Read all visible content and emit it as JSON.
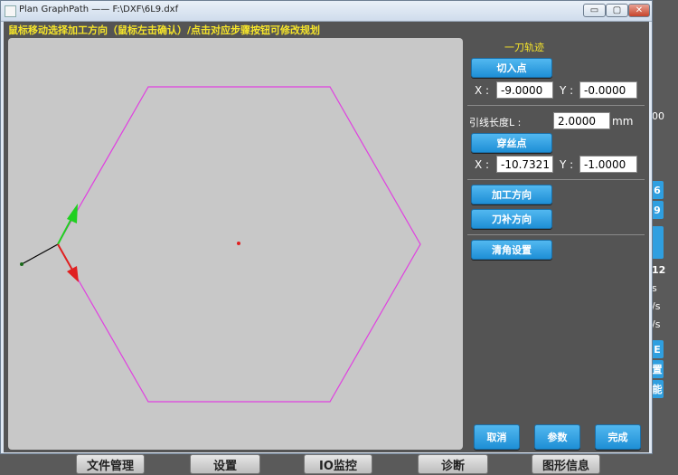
{
  "window": {
    "title": "Plan GraphPath —— F:\\DXF\\6L9.dxf",
    "min_glyph": "▭",
    "max_glyph": "▢",
    "close_glyph": "✕"
  },
  "instruction": "鼠标移动选择加工方向（鼠标左击确认）/点击对应步骤按钮可修改规划",
  "panel": {
    "title": "一刀轨迹",
    "cut_in_button": "切入点",
    "cut_in": {
      "x_label": "X :",
      "x_value": "-9.0000",
      "y_label": "Y :",
      "y_value": "-0.0000"
    },
    "lead_length_label": "引线长度L :",
    "lead_length_value": "2.0000",
    "lead_length_unit": "mm",
    "pierce_button": "穿丝点",
    "pierce": {
      "x_label": "X :",
      "x_value": "-10.7321",
      "y_label": "Y :",
      "y_value": "-1.0000"
    },
    "process_direction_button": "加工方向",
    "compensation_direction_button": "刀补方向",
    "corner_settings_button": "清角设置"
  },
  "footer": {
    "cancel_button": "取消",
    "params_button": "参数",
    "finish_button": "完成"
  },
  "background_app": {
    "bottom_buttons": [
      "文件管理",
      "设置",
      "IO监控",
      "诊断",
      "图形信息"
    ],
    "right_fragments": [
      "00",
      "6",
      "9",
      "12",
      "s",
      "/s",
      "/s",
      "E",
      "置",
      "能"
    ]
  },
  "colors": {
    "path": "#e040e0",
    "x_axis": "#e02020",
    "y_axis": "#20d020",
    "lead": "#000000",
    "button_blue": "#2fa0e6",
    "instruction_text": "#f6e52a"
  }
}
